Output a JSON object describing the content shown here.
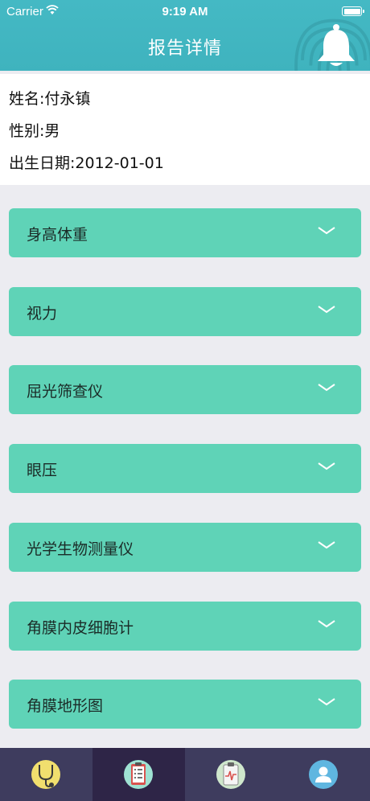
{
  "status_bar": {
    "carrier": "Carrier",
    "time": "9:19 AM",
    "wifi_icon": "wifi-icon",
    "battery_icon": "battery-icon"
  },
  "header": {
    "title": "报告详情",
    "bell_icon": "bell-icon",
    "background_icon": "fingerprint-icon",
    "color": "#42b8c3"
  },
  "profile": {
    "name": "姓名:付永镇",
    "gender": "性别:男",
    "birthdate": "出生日期:2012-01-01"
  },
  "sections": [
    {
      "label": "身高体重"
    },
    {
      "label": "视力"
    },
    {
      "label": "屈光筛查仪"
    },
    {
      "label": "眼压"
    },
    {
      "label": "光学生物测量仪"
    },
    {
      "label": "角膜内皮细胞计"
    },
    {
      "label": "角膜地形图"
    }
  ],
  "section_color": "#5fd3b7",
  "tabbar": {
    "active_index": 1,
    "tabs": [
      {
        "icon": "stethoscope-icon"
      },
      {
        "icon": "checklist-clipboard-icon"
      },
      {
        "icon": "medical-report-clipboard-icon"
      },
      {
        "icon": "user-profile-icon"
      }
    ]
  }
}
